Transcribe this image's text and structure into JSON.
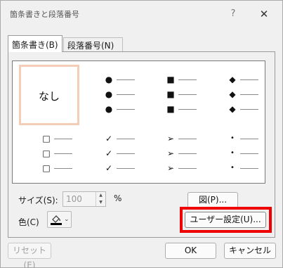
{
  "dialog": {
    "title": "箇条書きと段落番号",
    "help_glyph": "?",
    "close_glyph": "✕"
  },
  "tabs": [
    {
      "label": "箇条書き(B)",
      "active": true
    },
    {
      "label": "段落番号(N)",
      "active": false
    }
  ],
  "gallery": {
    "none_label": "なし",
    "selected_cell": "なし",
    "cells": [
      {
        "name": "filled-circle",
        "glyph": "●"
      },
      {
        "name": "filled-square",
        "glyph": "■"
      },
      {
        "name": "filled-diamond",
        "glyph": "◆"
      },
      {
        "name": "hollow-square",
        "glyph": "□"
      },
      {
        "name": "checkmark",
        "glyph": "✓"
      },
      {
        "name": "arrowhead",
        "glyph": "➢"
      },
      {
        "name": "small-dot",
        "glyph": "•"
      }
    ]
  },
  "size": {
    "label": "サイズ(S):",
    "value": "100",
    "unit": "%",
    "spin_up": "▲",
    "spin_down": "▼"
  },
  "color": {
    "label": "色(C)",
    "chevron": "⌄"
  },
  "buttons": {
    "picture": "図(P)...",
    "custom": "ユーザー設定(U)...",
    "reset": "リセット(E)",
    "ok": "OK",
    "cancel": "キャンセル"
  },
  "colors": {
    "selection_border": "#f4cdb7",
    "highlight": "#ee0000",
    "background": "#f0f0f0"
  }
}
